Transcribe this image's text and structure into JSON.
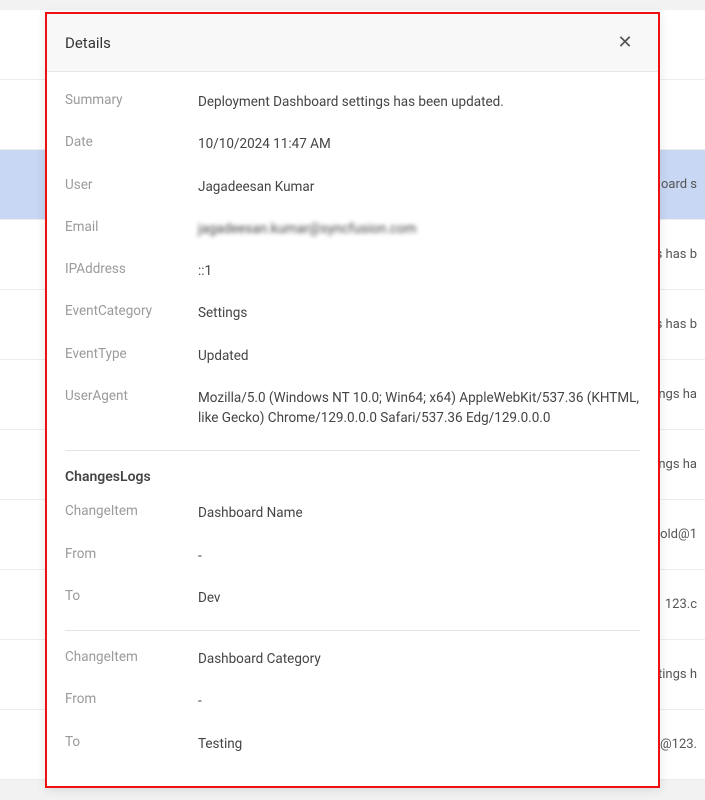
{
  "modal": {
    "title": "Details",
    "closeIcon": "✕"
  },
  "fields": {
    "summary_label": "Summary",
    "summary_value": "Deployment Dashboard settings has been updated.",
    "date_label": "Date",
    "date_value": "10/10/2024 11:47 AM",
    "user_label": "User",
    "user_value": "Jagadeesan Kumar",
    "email_label": "Email",
    "email_value": "jagadeesan.kumar@syncfusion.com",
    "ip_label": "IPAddress",
    "ip_value": "::1",
    "eventcat_label": "EventCategory",
    "eventcat_value": "Settings",
    "eventtype_label": "EventType",
    "eventtype_value": "Updated",
    "useragent_label": "UserAgent",
    "useragent_value": "Mozilla/5.0 (Windows NT 10.0; Win64; x64) AppleWebKit/537.36 (KHTML, like Gecko) Chrome/129.0.0.0 Safari/537.36 Edg/129.0.0.0"
  },
  "changes": {
    "title": "ChangesLogs",
    "item_label": "ChangeItem",
    "from_label": "From",
    "to_label": "To",
    "log1_item": "Dashboard Name",
    "log1_from": "-",
    "log1_to": "Dev",
    "log2_item": "Dashboard Category",
    "log2_from": "-",
    "log2_to": "Testing"
  },
  "bg": {
    "r1": "oard s",
    "r2": "s has b",
    "r3": "s has b",
    "r4": "ings ha",
    "r5": "ings ha",
    "r6": "old@1",
    "r7": "123.c",
    "r8": "tings h",
    "r9": "@123."
  }
}
